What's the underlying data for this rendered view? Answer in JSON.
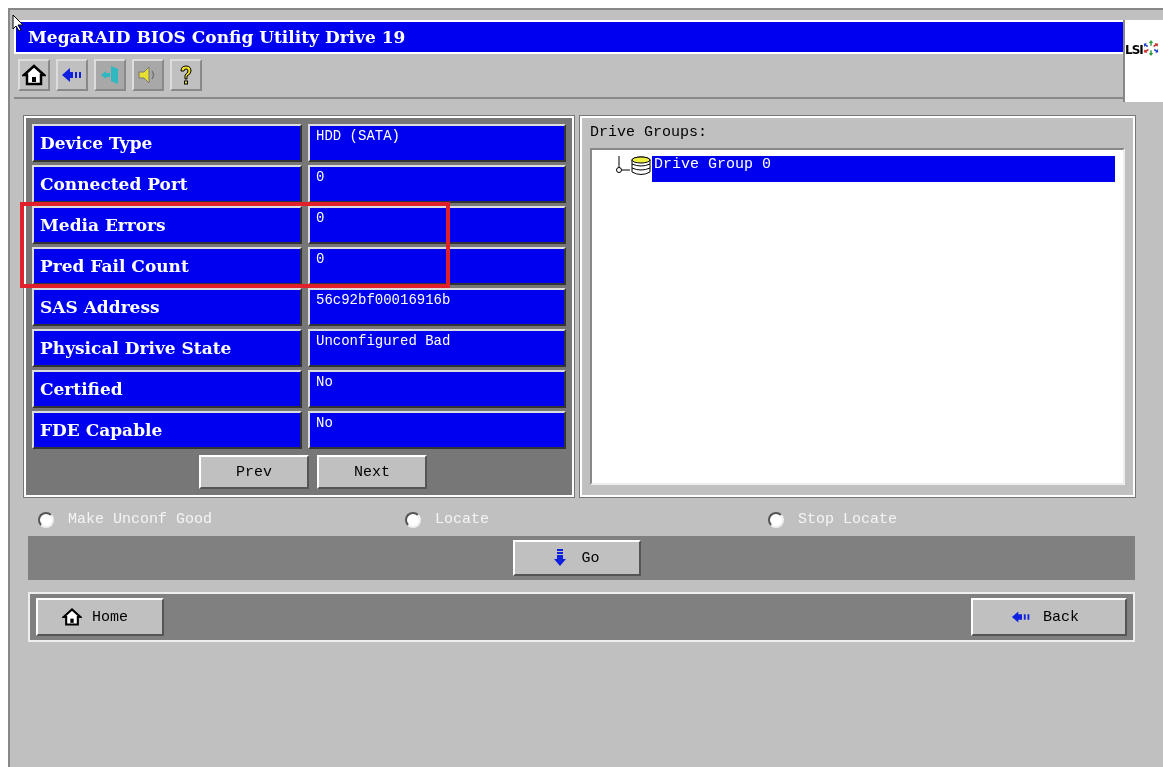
{
  "window": {
    "title": "MegaRAID BIOS Config Utility Drive 19",
    "logo": "LSI"
  },
  "properties": [
    {
      "label": "Device Type",
      "value": "HDD (SATA)",
      "highlighted": false
    },
    {
      "label": "Connected Port",
      "value": "0",
      "highlighted": false
    },
    {
      "label": "Media Errors",
      "value": "0",
      "highlighted": true
    },
    {
      "label": "Pred Fail Count",
      "value": "0",
      "highlighted": true
    },
    {
      "label": "SAS Address",
      "value": "56c92bf00016916b",
      "highlighted": false
    },
    {
      "label": "Physical Drive State",
      "value": "Unconfigured Bad",
      "highlighted": false
    },
    {
      "label": "Certified",
      "value": "No",
      "highlighted": false
    },
    {
      "label": "FDE Capable",
      "value": "No",
      "highlighted": false
    }
  ],
  "pager": [
    "Prev",
    "Next"
  ],
  "drive_groups": {
    "heading": "Drive Groups:",
    "items": [
      {
        "label": "Drive Group 0",
        "selected": true
      }
    ]
  },
  "actions": [
    {
      "label": "Make Unconf Good",
      "selected": false
    },
    {
      "label": "Locate",
      "selected": false
    },
    {
      "label": "Stop Locate",
      "selected": false
    }
  ],
  "go_button": "Go",
  "home_button": "Home",
  "back_button": "Back"
}
